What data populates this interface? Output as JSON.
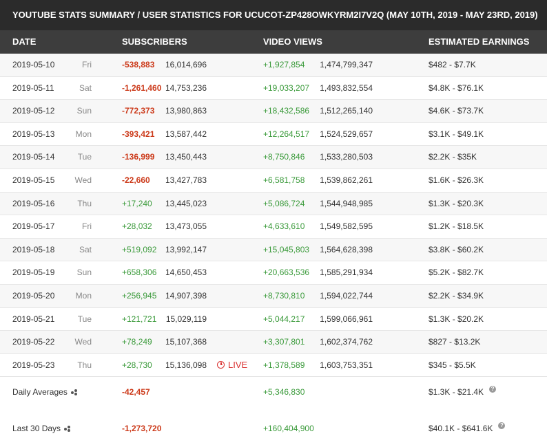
{
  "title": "YOUTUBE STATS SUMMARY / USER STATISTICS FOR UCUCOT-ZP428OWKYRM2I7V2Q (MAY 10TH, 2019 - MAY 23RD, 2019)",
  "columns": {
    "date": "DATE",
    "subscribers": "SUBSCRIBERS",
    "views": "VIDEO VIEWS",
    "earnings": "ESTIMATED EARNINGS"
  },
  "rows": [
    {
      "date": "2019-05-10",
      "day": "Fri",
      "sub_delta": "-538,883",
      "sub_total": "16,014,696",
      "view_delta": "+1,927,854",
      "view_total": "1,474,799,347",
      "earnings": "$482  -  $7.7K"
    },
    {
      "date": "2019-05-11",
      "day": "Sat",
      "sub_delta": "-1,261,460",
      "sub_total": "14,753,236",
      "view_delta": "+19,033,207",
      "view_total": "1,493,832,554",
      "earnings": "$4.8K  -  $76.1K"
    },
    {
      "date": "2019-05-12",
      "day": "Sun",
      "sub_delta": "-772,373",
      "sub_total": "13,980,863",
      "view_delta": "+18,432,586",
      "view_total": "1,512,265,140",
      "earnings": "$4.6K  -  $73.7K"
    },
    {
      "date": "2019-05-13",
      "day": "Mon",
      "sub_delta": "-393,421",
      "sub_total": "13,587,442",
      "view_delta": "+12,264,517",
      "view_total": "1,524,529,657",
      "earnings": "$3.1K  -  $49.1K"
    },
    {
      "date": "2019-05-14",
      "day": "Tue",
      "sub_delta": "-136,999",
      "sub_total": "13,450,443",
      "view_delta": "+8,750,846",
      "view_total": "1,533,280,503",
      "earnings": "$2.2K  -  $35K"
    },
    {
      "date": "2019-05-15",
      "day": "Wed",
      "sub_delta": "-22,660",
      "sub_total": "13,427,783",
      "view_delta": "+6,581,758",
      "view_total": "1,539,862,261",
      "earnings": "$1.6K  -  $26.3K"
    },
    {
      "date": "2019-05-16",
      "day": "Thu",
      "sub_delta": "+17,240",
      "sub_total": "13,445,023",
      "view_delta": "+5,086,724",
      "view_total": "1,544,948,985",
      "earnings": "$1.3K  -  $20.3K"
    },
    {
      "date": "2019-05-17",
      "day": "Fri",
      "sub_delta": "+28,032",
      "sub_total": "13,473,055",
      "view_delta": "+4,633,610",
      "view_total": "1,549,582,595",
      "earnings": "$1.2K  -  $18.5K"
    },
    {
      "date": "2019-05-18",
      "day": "Sat",
      "sub_delta": "+519,092",
      "sub_total": "13,992,147",
      "view_delta": "+15,045,803",
      "view_total": "1,564,628,398",
      "earnings": "$3.8K  -  $60.2K"
    },
    {
      "date": "2019-05-19",
      "day": "Sun",
      "sub_delta": "+658,306",
      "sub_total": "14,650,453",
      "view_delta": "+20,663,536",
      "view_total": "1,585,291,934",
      "earnings": "$5.2K  -  $82.7K"
    },
    {
      "date": "2019-05-20",
      "day": "Mon",
      "sub_delta": "+256,945",
      "sub_total": "14,907,398",
      "view_delta": "+8,730,810",
      "view_total": "1,594,022,744",
      "earnings": "$2.2K  -  $34.9K"
    },
    {
      "date": "2019-05-21",
      "day": "Tue",
      "sub_delta": "+121,721",
      "sub_total": "15,029,119",
      "view_delta": "+5,044,217",
      "view_total": "1,599,066,961",
      "earnings": "$1.3K  -  $20.2K"
    },
    {
      "date": "2019-05-22",
      "day": "Wed",
      "sub_delta": "+78,249",
      "sub_total": "15,107,368",
      "view_delta": "+3,307,801",
      "view_total": "1,602,374,762",
      "earnings": "$827  -  $13.2K"
    },
    {
      "date": "2019-05-23",
      "day": "Thu",
      "sub_delta": "+28,730",
      "sub_total": "15,136,098",
      "live": "LIVE",
      "view_delta": "+1,378,589",
      "view_total": "1,603,753,351",
      "earnings": "$345  -  $5.5K"
    }
  ],
  "summary": {
    "daily_averages": {
      "label": "Daily Averages",
      "subs": "-42,457",
      "views": "+5,346,830",
      "earnings": "$1.3K  -  $21.4K"
    },
    "last_30_days": {
      "label": "Last 30 Days",
      "subs": "-1,273,720",
      "views": "+160,404,900",
      "earnings": "$40.1K  -  $641.6K"
    }
  },
  "colors": {
    "negative": "#cc3a1a",
    "positive": "#3a9a3a",
    "live": "#d9302f",
    "title_bg": "#2b2b2b",
    "header_bg": "#3d3d3d"
  },
  "icons": [
    "clock-icon",
    "share-icon",
    "help-icon"
  ]
}
